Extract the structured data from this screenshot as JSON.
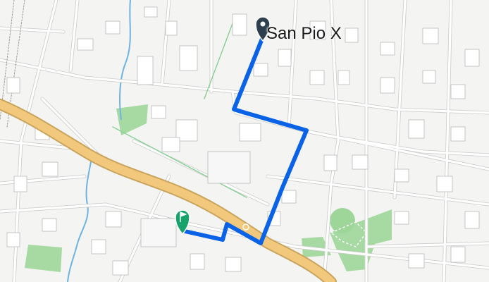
{
  "map": {
    "place_label": "San Pio X",
    "colors": {
      "background": "#f4f4f2",
      "building_fill": "#ffffff",
      "building_stroke": "#b9b9b9",
      "road": "#ffffff",
      "road_outline": "#c8c8c8",
      "highway": "#f2c97c",
      "highway_outline": "#c9a45c",
      "park": "#9ed69a",
      "water": "#6fb3e0",
      "route": "#0a63e6",
      "start_marker": "#2d3f4d",
      "end_marker": "#17a36b"
    },
    "markers": [
      {
        "name": "start-marker",
        "icon": "pin-icon"
      },
      {
        "name": "end-marker",
        "icon": "flag-pin-icon"
      }
    ]
  }
}
